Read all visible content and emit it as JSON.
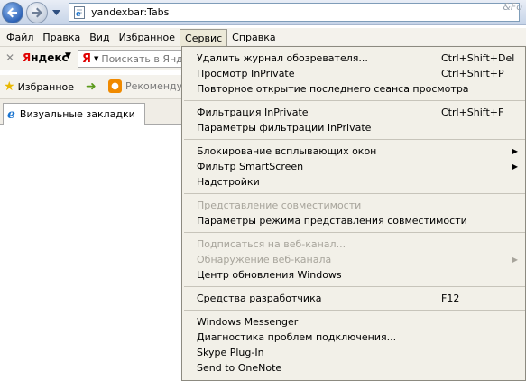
{
  "address_bar": {
    "url": "yandexbar:Tabs",
    "search_hint": "&Fo"
  },
  "menubar": {
    "items": [
      "Файл",
      "Правка",
      "Вид",
      "Избранное",
      "Сервис",
      "Справка"
    ],
    "active": "Сервис"
  },
  "yandex_toolbar": {
    "logo": "Яндекс",
    "search_placeholder": "Поискать в Янде"
  },
  "favorites_bar": {
    "favorites_label": "Избранное",
    "suggested_label": "Рекомендуе"
  },
  "tab": {
    "label": "Визуальные закладки"
  },
  "tools_menu": {
    "groups": [
      [
        {
          "label": "Удалить журнал обозревателя...",
          "shortcut": "Ctrl+Shift+Del"
        },
        {
          "label": "Просмотр InPrivate",
          "shortcut": "Ctrl+Shift+P"
        },
        {
          "label": "Повторное открытие последнего сеанса просмотра"
        }
      ],
      [
        {
          "label": "Фильтрация InPrivate",
          "shortcut": "Ctrl+Shift+F"
        },
        {
          "label": "Параметры фильтрации InPrivate"
        }
      ],
      [
        {
          "label": "Блокирование всплывающих окон",
          "submenu": true
        },
        {
          "label": "Фильтр SmartScreen",
          "submenu": true
        },
        {
          "label": "Надстройки"
        }
      ],
      [
        {
          "label": "Представление совместимости",
          "disabled": true
        },
        {
          "label": "Параметры режима представления совместимости"
        }
      ],
      [
        {
          "label": "Подписаться на веб-канал...",
          "disabled": true
        },
        {
          "label": "Обнаружение веб-канала",
          "disabled": true,
          "submenu": true
        },
        {
          "label": "Центр обновления Windows"
        }
      ],
      [
        {
          "label": "Средства разработчика",
          "shortcut": "F12"
        }
      ],
      [
        {
          "label": "Windows Messenger"
        },
        {
          "label": "Диагностика проблем подключения..."
        },
        {
          "label": "Skype Plug-In"
        },
        {
          "label": "Send to OneNote"
        }
      ]
    ]
  },
  "colors": {
    "menu_bg": "#f2f0e8",
    "disabled_text": "#a7a49b",
    "yandex_red": "#e00000"
  }
}
